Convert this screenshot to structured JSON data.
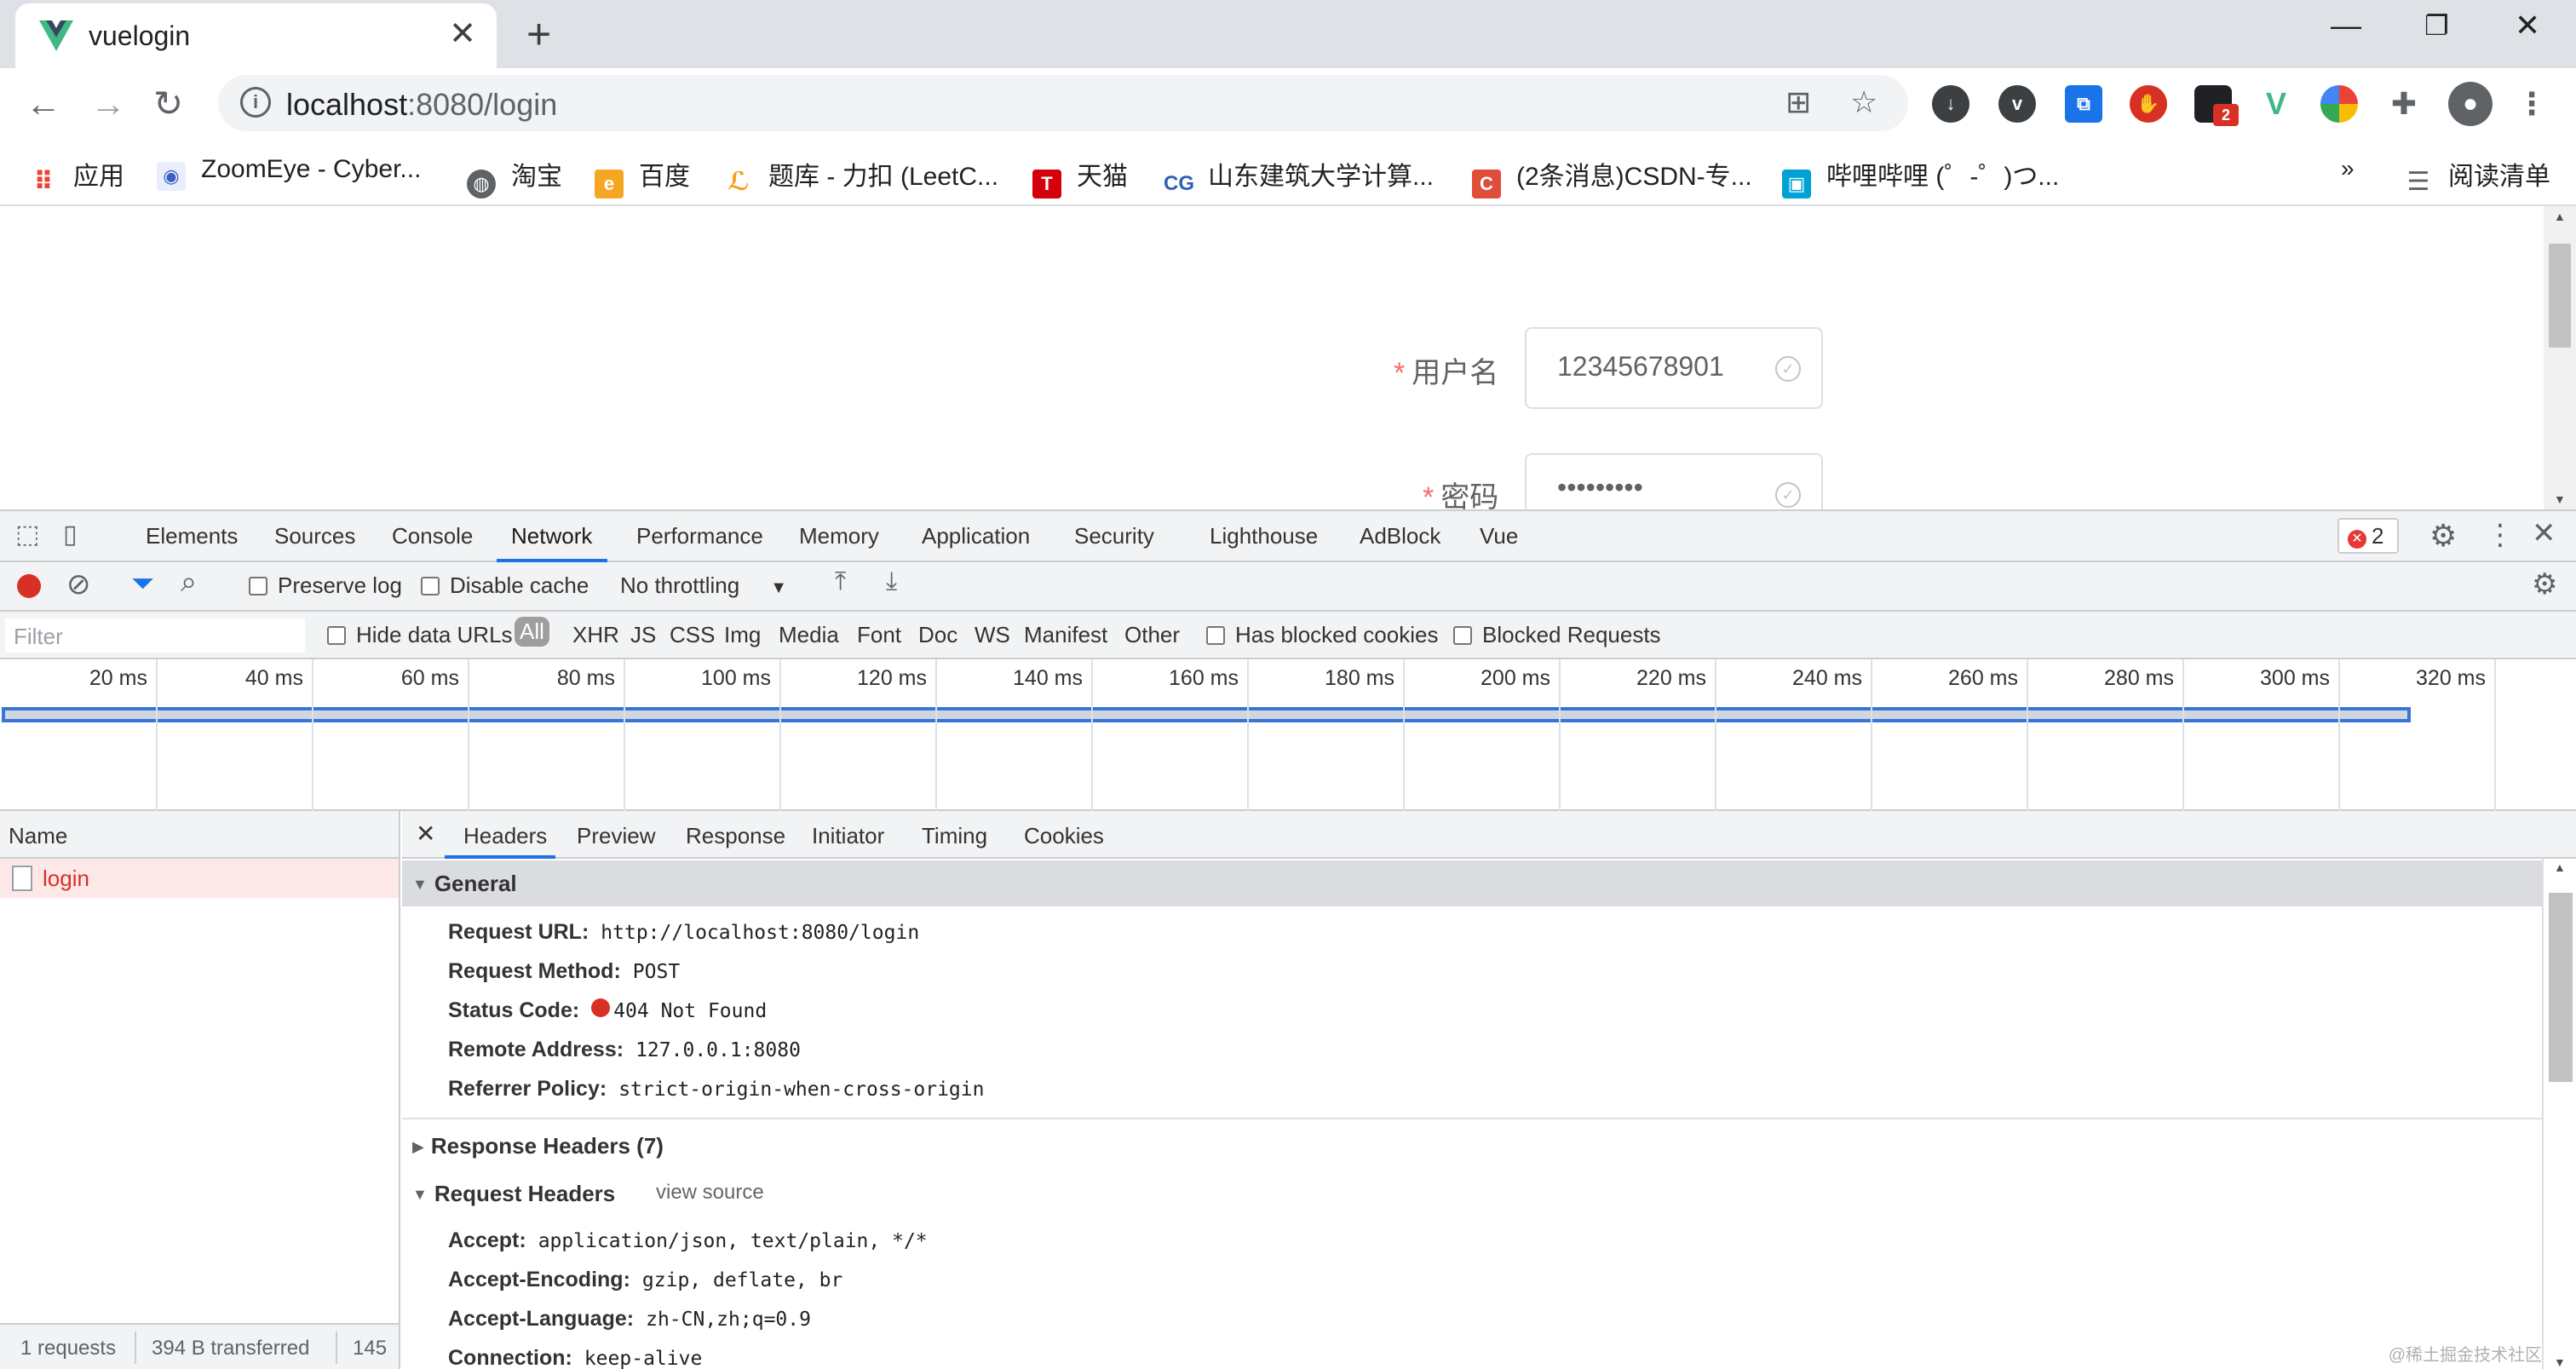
{
  "browser": {
    "tab_title": "vuelogin",
    "url_host": "localhost",
    "url_rest": ":8080/login",
    "bookmarks": [
      {
        "label": "应用",
        "icon": "apps-grid-icon",
        "color": "#ea4335"
      },
      {
        "label": "ZoomEye - Cyber...",
        "icon": "zoomeye-icon",
        "color": "#3b5fc0"
      },
      {
        "label": "淘宝",
        "icon": "globe-icon",
        "color": "#5f6368"
      },
      {
        "label": "百度",
        "icon": "baidu-icon",
        "color": "#f5a623"
      },
      {
        "label": "题库 - 力扣 (LeetC...",
        "icon": "leetcode-icon",
        "color": "#f89f1b"
      },
      {
        "label": "天猫",
        "icon": "tmall-icon",
        "color": "#d4000b"
      },
      {
        "label": "山东建筑大学计算...",
        "icon": "sdjzu-icon",
        "color": "#2e60b8"
      },
      {
        "label": "(2条消息)CSDN-专...",
        "icon": "csdn-icon",
        "color": "#e14d3b"
      },
      {
        "label": "哔哩哔哩 (゜-゜)つ...",
        "icon": "bilibili-icon",
        "color": "#00a1d6"
      }
    ],
    "bookmarks_overflow": "»",
    "reading_list": "阅读清单",
    "extension_badge": "2"
  },
  "page": {
    "username_label": "用户名",
    "username_value": "12345678901",
    "password_label": "密码",
    "password_value": "•••••••••",
    "required_mark": "*"
  },
  "devtools": {
    "tabs": [
      "Elements",
      "Sources",
      "Console",
      "Network",
      "Performance",
      "Memory",
      "Application",
      "Security",
      "Lighthouse",
      "AdBlock",
      "Vue"
    ],
    "active_tab": "Network",
    "error_count": "2",
    "toolbar": {
      "preserve_log": "Preserve log",
      "disable_cache": "Disable cache",
      "throttling": "No throttling"
    },
    "filter": {
      "placeholder": "Filter",
      "hide_data_urls": "Hide data URLs",
      "types": [
        "All",
        "XHR",
        "JS",
        "CSS",
        "Img",
        "Media",
        "Font",
        "Doc",
        "WS",
        "Manifest",
        "Other"
      ],
      "has_blocked_cookies": "Has blocked cookies",
      "blocked_requests": "Blocked Requests"
    },
    "timeline_ticks": [
      "20 ms",
      "40 ms",
      "60 ms",
      "80 ms",
      "100 ms",
      "120 ms",
      "140 ms",
      "160 ms",
      "180 ms",
      "200 ms",
      "220 ms",
      "240 ms",
      "260 ms",
      "280 ms",
      "300 ms",
      "320 ms"
    ],
    "request_list": {
      "header": "Name",
      "rows": [
        "login"
      ],
      "summary": {
        "requests": "1 requests",
        "transferred": "394 B transferred",
        "extra": "145"
      }
    },
    "detail": {
      "tabs": [
        "Headers",
        "Preview",
        "Response",
        "Initiator",
        "Timing",
        "Cookies"
      ],
      "active_tab": "Headers",
      "general_title": "General",
      "general": [
        {
          "k": "Request URL:",
          "v": "http://localhost:8080/login"
        },
        {
          "k": "Request Method:",
          "v": "POST"
        },
        {
          "k": "Status Code:",
          "v": "404 Not Found"
        },
        {
          "k": "Remote Address:",
          "v": "127.0.0.1:8080"
        },
        {
          "k": "Referrer Policy:",
          "v": "strict-origin-when-cross-origin"
        }
      ],
      "response_headers_title": "Response Headers (7)",
      "request_headers_title": "Request Headers",
      "view_source": "view source",
      "request_headers": [
        {
          "k": "Accept:",
          "v": "application/json, text/plain, */*"
        },
        {
          "k": "Accept-Encoding:",
          "v": "gzip, deflate, br"
        },
        {
          "k": "Accept-Language:",
          "v": "zh-CN,zh;q=0.9"
        },
        {
          "k": "Connection:",
          "v": "keep-alive"
        }
      ]
    },
    "watermark": "@稀土掘金技术社区"
  }
}
